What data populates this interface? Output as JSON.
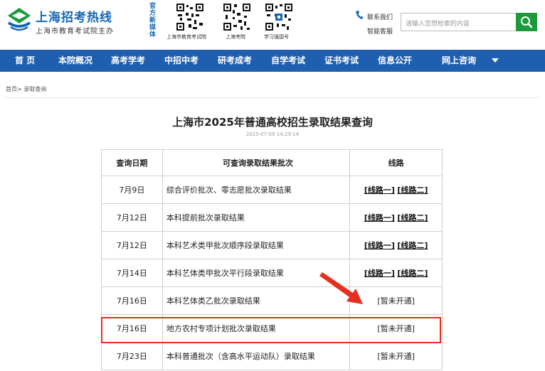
{
  "header": {
    "title": "上海招考热线",
    "subtitle": "上海市教育考试院主办",
    "media_label": "官方新媒体",
    "qrcodes": [
      {
        "caption": "上海市教育考试院"
      },
      {
        "caption": "上海考院"
      },
      {
        "caption": "学习强国号"
      }
    ],
    "contact_label": "联系我们",
    "service_label": "智能客服",
    "search_placeholder": "请输入您想检索的内容"
  },
  "nav": {
    "items": [
      "首 页",
      "本院概况",
      "高考学考",
      "中招中考",
      "研考成考",
      "自学考试",
      "证书考试",
      "信息公开",
      "网上咨询"
    ]
  },
  "breadcrumb": {
    "home": "首页",
    "separator": ">",
    "current": "录取查询"
  },
  "article": {
    "title": "上海市2025年普通高校招生录取结果查询",
    "time": "2025-07-09 14:29:14"
  },
  "table": {
    "headers": [
      "查询日期",
      "可查询录取结果批次",
      "线路"
    ],
    "route1_label": "[线路一]",
    "route2_label": "[线路二]",
    "rows": [
      {
        "date": "7月9日",
        "batch": "综合评价批次、零志愿批次录取结果",
        "status": ""
      },
      {
        "date": "7月12日",
        "batch": "本科提前批次录取结果",
        "status": ""
      },
      {
        "date": "7月12日",
        "batch": "本科艺术类甲批次顺序段录取结果",
        "status": ""
      },
      {
        "date": "7月14日",
        "batch": "本科艺体类甲批次平行段录取结果",
        "status": ""
      },
      {
        "date": "7月16日",
        "batch": "本科艺体类乙批次录取结果",
        "status": "[暂未开通]"
      },
      {
        "date": "7月16日",
        "batch": "地方农村专项计划批次录取结果",
        "status": "[暂未开通]"
      },
      {
        "date": "7月23日",
        "batch": "本科普通批次（含高水平运动队）录取结果",
        "status": "[暂未开通]"
      }
    ]
  },
  "colors": {
    "brand_blue": "#1467b3",
    "nav_blue": "#1f5fb0",
    "search_green": "#1c9a3b",
    "highlight_red": "#e5301d"
  }
}
